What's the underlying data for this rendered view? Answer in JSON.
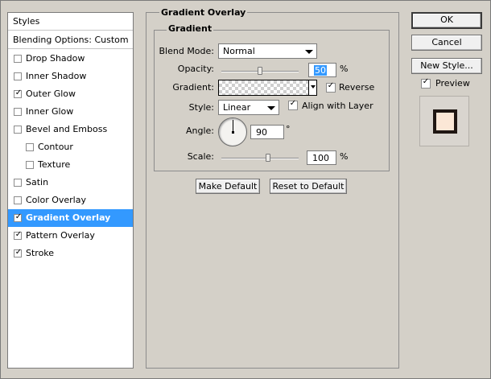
{
  "left_panel": {
    "header": "Styles",
    "blending": "Blending Options: Custom",
    "items": [
      {
        "label": "Drop Shadow",
        "checked": false
      },
      {
        "label": "Inner Shadow",
        "checked": false
      },
      {
        "label": "Outer Glow",
        "checked": true
      },
      {
        "label": "Inner Glow",
        "checked": false
      },
      {
        "label": "Bevel and Emboss",
        "checked": false
      },
      {
        "label": "Contour",
        "checked": false
      },
      {
        "label": "Texture",
        "checked": false
      },
      {
        "label": "Satin",
        "checked": false
      },
      {
        "label": "Color Overlay",
        "checked": false
      },
      {
        "label": "Gradient Overlay",
        "checked": true,
        "selected": true
      },
      {
        "label": "Pattern Overlay",
        "checked": true
      },
      {
        "label": "Stroke",
        "checked": true
      }
    ],
    "check_glyph": "✓"
  },
  "panel": {
    "title": "Gradient Overlay",
    "section": "Gradient",
    "blend_mode_label": "Blend Mode:",
    "blend_mode_value": "Normal",
    "opacity_label": "Opacity:",
    "opacity_value": "50",
    "opacity_unit": "%",
    "opacity_slider_fraction": 0.5,
    "gradient_label": "Gradient:",
    "reverse_label": "Reverse",
    "reverse_checked": true,
    "style_label": "Style:",
    "style_value": "Linear",
    "align_label": "Align with Layer",
    "align_checked": true,
    "angle_label": "Angle:",
    "angle_value": "90",
    "angle_unit": "°",
    "angle_degrees": 90,
    "scale_label": "Scale:",
    "scale_value": "100",
    "scale_unit": "%",
    "scale_slider_fraction": 0.6,
    "make_default": "Make Default",
    "reset_default": "Reset to Default"
  },
  "right": {
    "ok": "OK",
    "cancel": "Cancel",
    "new_style": "New Style...",
    "preview_label": "Preview",
    "preview_checked": true
  },
  "colors": {
    "dialog_bg": "#d4d0c8",
    "selection": "#3399ff",
    "preview_fill": "#fbe7d6",
    "preview_stroke": "#1f1612"
  }
}
